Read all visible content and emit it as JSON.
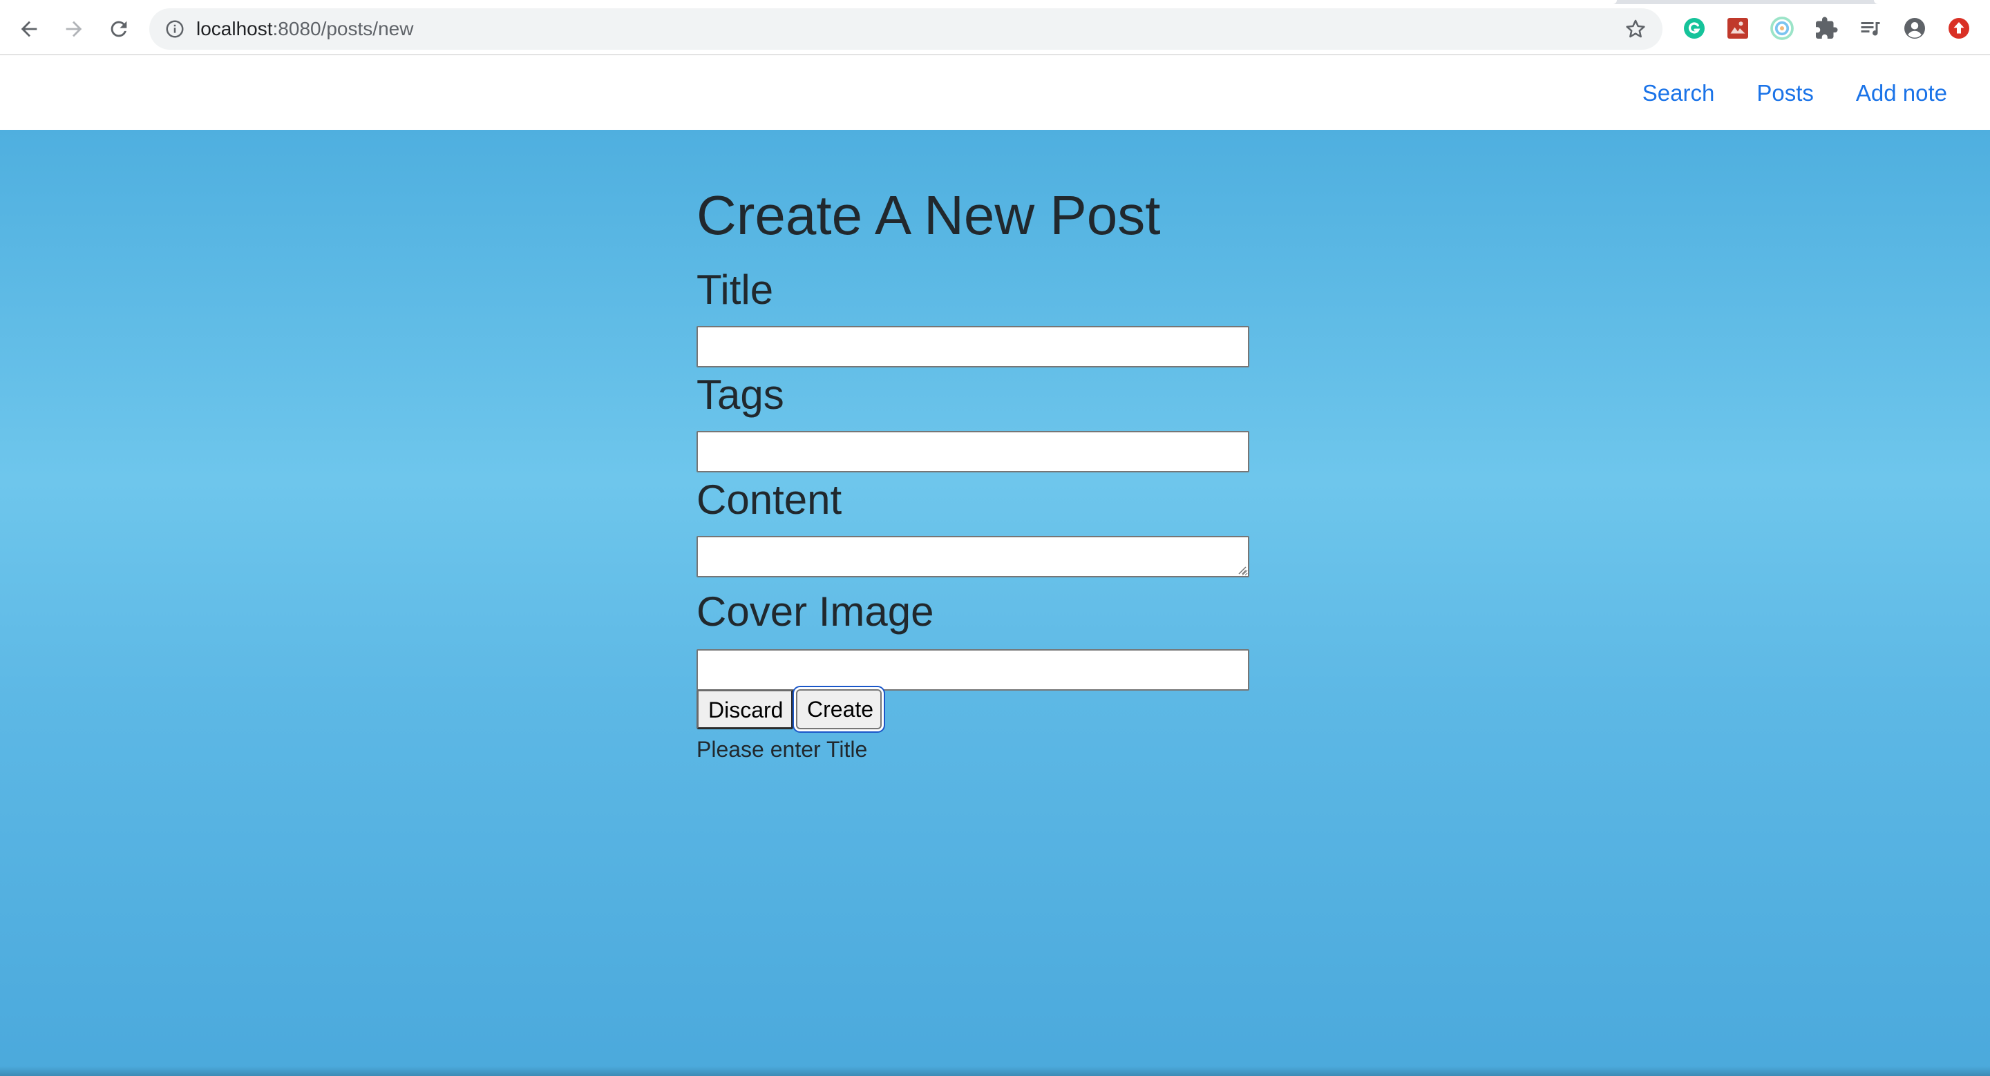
{
  "browser": {
    "url_host": "localhost",
    "url_rest": ":8080/posts/new"
  },
  "navbar": {
    "links": [
      "Search",
      "Posts",
      "Add note"
    ]
  },
  "form": {
    "title": "Create A New Post",
    "fields": {
      "title_label": "Title",
      "title_value": "",
      "tags_label": "Tags",
      "tags_value": "",
      "content_label": "Content",
      "content_value": "",
      "cover_label": "Cover Image",
      "cover_value": ""
    },
    "discard_label": "Discard",
    "create_label": "Create",
    "error_message": "Please enter Title"
  },
  "colors": {
    "link": "#1a73e8",
    "hero_top": "#4fafdf",
    "hero_mid": "#6ec6ec",
    "hero_bottom": "#4ba9dc",
    "focus_ring": "#1a56c8"
  }
}
